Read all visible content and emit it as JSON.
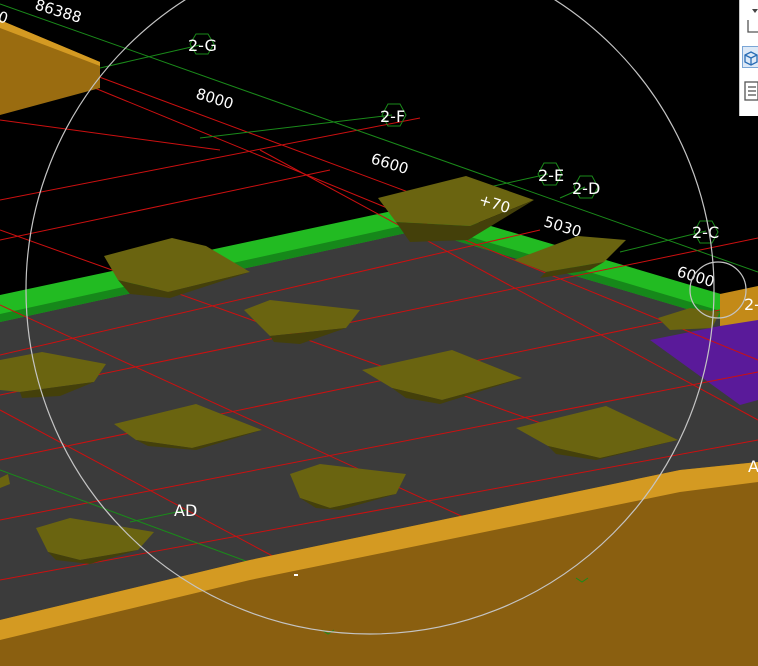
{
  "viewport": {
    "grid_labels": [
      "2-G",
      "2-F",
      "2-E",
      "2-D",
      "2-C",
      "2-",
      "AD",
      "A"
    ],
    "dimensions": [
      "86388",
      "8000",
      "6600",
      "+70",
      "5030",
      "6000",
      "0"
    ]
  },
  "colors": {
    "background": "#000000",
    "floor": "#3a3a3a",
    "green_band": "#22bb22",
    "footing": "#55520a",
    "wall": "#c38a18",
    "purple": "#5a1a9a",
    "grid_line": "#cc1010",
    "dim_line": "#1a8a1a",
    "orbit_circle": "#bbbbbb"
  },
  "toolbar": {
    "items": [
      "dropdown-arrow-icon",
      "view-cube-icon",
      "3d-box-icon",
      "properties-list-icon"
    ]
  }
}
